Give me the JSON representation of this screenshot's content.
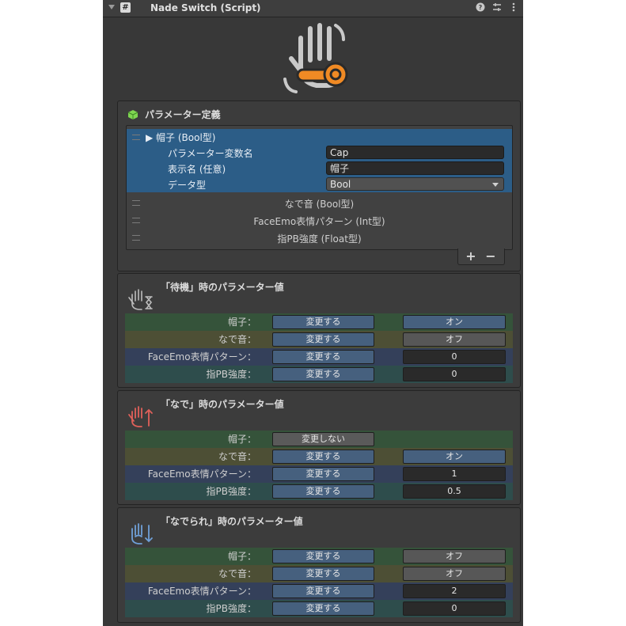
{
  "header": {
    "title": "Nade Switch (Script)",
    "script_glyph": "#",
    "icons": [
      "help-icon",
      "presets-icon",
      "more-icon"
    ]
  },
  "param_panel": {
    "title": "パラメーター定義",
    "selected": {
      "label": "▶ 帽子 (Bool型)",
      "fields": [
        {
          "label": "パラメーター変数名",
          "value": "Cap"
        },
        {
          "label": "表示名 (任意)",
          "value": "帽子"
        },
        {
          "label": "データ型",
          "value": "Bool"
        }
      ]
    },
    "others": [
      "なで音 (Bool型)",
      "FaceEmo表情パターン (Int型)",
      "指PB強度 (Float型)"
    ],
    "add": "+",
    "remove": "−"
  },
  "states": [
    {
      "title": "「待機」時のパラメーター値",
      "rows": [
        {
          "label": "帽子：",
          "button": "変更する",
          "value": "オン"
        },
        {
          "label": "なで音：",
          "button": "変更する",
          "value": "オフ"
        },
        {
          "label": "FaceEmo表情パターン：",
          "button": "変更する",
          "value": "0"
        },
        {
          "label": "指PB強度：",
          "button": "変更する",
          "value": "0"
        }
      ]
    },
    {
      "title": "「なで」時のパラメーター値",
      "rows": [
        {
          "label": "帽子：",
          "button": "変更しない",
          "value": ""
        },
        {
          "label": "なで音：",
          "button": "変更する",
          "value": "オン"
        },
        {
          "label": "FaceEmo表情パターン：",
          "button": "変更する",
          "value": "1"
        },
        {
          "label": "指PB強度：",
          "button": "変更する",
          "value": "0.5"
        }
      ]
    },
    {
      "title": "「なでられ」時のパラメーター値",
      "rows": [
        {
          "label": "帽子：",
          "button": "変更する",
          "value": "オフ"
        },
        {
          "label": "なで音：",
          "button": "変更する",
          "value": "オフ"
        },
        {
          "label": "FaceEmo表情パターン：",
          "button": "変更する",
          "value": "2"
        },
        {
          "label": "指PB強度：",
          "button": "変更する",
          "value": "0"
        }
      ]
    }
  ],
  "colors": {
    "accent_orange": "#f08a24",
    "hand_gray": "#c9c9c9",
    "stroke_red": "#e0605a",
    "blue_icon": "#6fa0d8"
  }
}
